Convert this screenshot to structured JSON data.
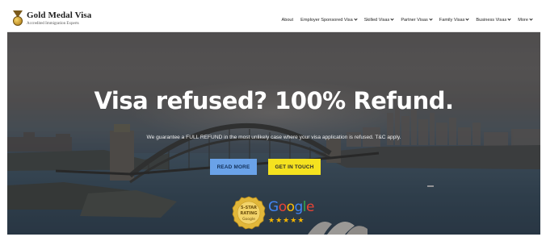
{
  "header": {
    "brand_name": "Gold Medal Visa",
    "brand_tagline": "Accredited Immigration Experts",
    "nav": [
      {
        "label": "About",
        "dropdown": false
      },
      {
        "label": "Employer Sponsored Visa",
        "dropdown": true
      },
      {
        "label": "Skilled Visas",
        "dropdown": true
      },
      {
        "label": "Partner Visas",
        "dropdown": true
      },
      {
        "label": "Family Visas",
        "dropdown": true
      },
      {
        "label": "Business Visas",
        "dropdown": true
      },
      {
        "label": "More",
        "dropdown": true
      }
    ]
  },
  "hero": {
    "headline": "Visa refused? 100% Refund.",
    "subline": "We guarantee a FULL REFUND in the most unlikely case where your visa application is refused. T&C apply.",
    "read_more": "READ MORE",
    "get_in_touch": "GET IN TOUCH",
    "badge": {
      "line1": "5-STAR",
      "line2": "RATING",
      "line3": "Google"
    },
    "google_word": "Google",
    "rating_stars": 5
  },
  "colors": {
    "read_more_bg": "#6aa2e8",
    "get_in_touch_bg": "#f5e21f",
    "star": "#f4b400"
  }
}
